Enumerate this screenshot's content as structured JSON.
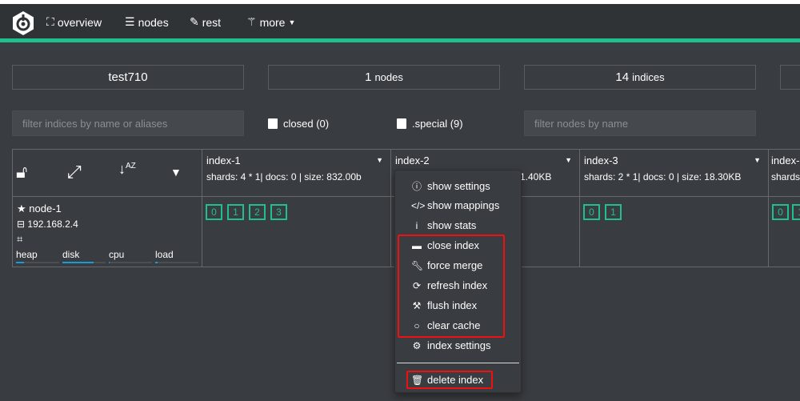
{
  "nav": {
    "items": [
      {
        "label": "overview",
        "icon": "sitemap-icon"
      },
      {
        "label": "nodes",
        "icon": "server-icon"
      },
      {
        "label": "rest",
        "icon": "edit-icon"
      },
      {
        "label": "more",
        "icon": "magic-wand-icon"
      }
    ]
  },
  "colors": {
    "accent": "#1fc08e",
    "highlight": "#f01010",
    "bar": "#1a9ad6"
  },
  "cards": [
    {
      "value": "test710",
      "unit": ""
    },
    {
      "value": "1",
      "unit": "nodes"
    },
    {
      "value": "14",
      "unit": "indices"
    }
  ],
  "filters": {
    "indices_placeholder": "filter indices by name or aliases",
    "closed_label": "closed (0)",
    "special_label": ".special (9)",
    "nodes_placeholder": "filter nodes by name"
  },
  "indices": [
    {
      "name": "index-1",
      "info": "shards: 4 * 1| docs: 0 | size: 832.00b",
      "shards": [
        "0",
        "1",
        "2",
        "3"
      ]
    },
    {
      "name": "index-2",
      "info": "1.40KB",
      "shards": []
    },
    {
      "name": "index-3",
      "info": "shards: 2 * 1| docs: 0 | size: 18.30KB",
      "shards": [
        "0",
        "1"
      ]
    },
    {
      "name": "index-",
      "info": "shards",
      "shards": [
        "0",
        "1"
      ]
    }
  ],
  "node": {
    "name": "node-1",
    "ip": "192.168.2.4",
    "metrics": [
      {
        "label": "heap",
        "percent": 18
      },
      {
        "label": "disk",
        "percent": 72
      },
      {
        "label": "cpu",
        "percent": 2
      },
      {
        "label": "load",
        "percent": 5
      }
    ]
  },
  "menu": {
    "items": [
      "show settings",
      "show mappings",
      "show stats",
      "close index",
      "force merge",
      "refresh index",
      "flush index",
      "clear cache",
      "index settings"
    ],
    "delete": "delete index"
  }
}
